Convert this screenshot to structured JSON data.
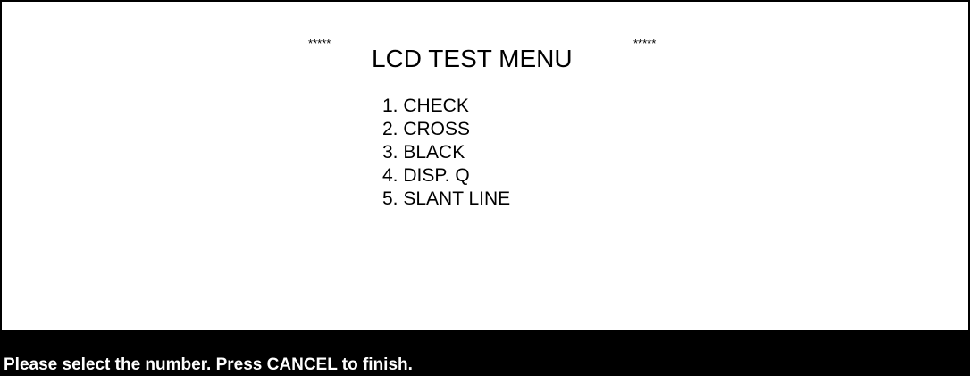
{
  "header": {
    "stars_left": "*****",
    "title": "LCD TEST MENU",
    "stars_right": "*****"
  },
  "menu": {
    "items": [
      {
        "label": "1. CHECK"
      },
      {
        "label": "2. CROSS"
      },
      {
        "label": "3. BLACK"
      },
      {
        "label": "4. DISP. Q"
      },
      {
        "label": "5. SLANT LINE"
      }
    ]
  },
  "status_bar": {
    "message": "Please select the number. Press CANCEL to finish."
  },
  "colors": {
    "background": "#ffffff",
    "text": "#000000",
    "status_bar_background": "#000000",
    "status_bar_text": "#ffffff"
  }
}
